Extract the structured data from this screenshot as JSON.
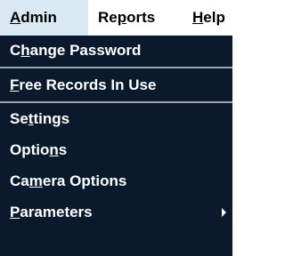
{
  "menubar": {
    "items": [
      {
        "pre": "",
        "mn": "A",
        "post": "dmin"
      },
      {
        "pre": "Re",
        "mn": "p",
        "post": "orts"
      },
      {
        "pre": "",
        "mn": "H",
        "post": "elp"
      }
    ]
  },
  "menu": {
    "items": [
      {
        "pre": "C",
        "mn": "h",
        "post": "ange Password"
      },
      {
        "pre": "",
        "mn": "F",
        "post": "ree Records In Use"
      },
      {
        "pre": "Se",
        "mn": "t",
        "post": "tings"
      },
      {
        "pre": "Optio",
        "mn": "n",
        "post": "s"
      },
      {
        "pre": "Ca",
        "mn": "m",
        "post": "era Options"
      },
      {
        "pre": "",
        "mn": "P",
        "post": "arameters"
      }
    ]
  },
  "colors": {
    "menu_background": "#0a1a2c",
    "menu_text": "#ffffff",
    "active_menubar_item": "#d9e9f2",
    "separator": "#9aa2ab"
  },
  "icons": {
    "submenu_arrow": "chevron-right-icon"
  }
}
